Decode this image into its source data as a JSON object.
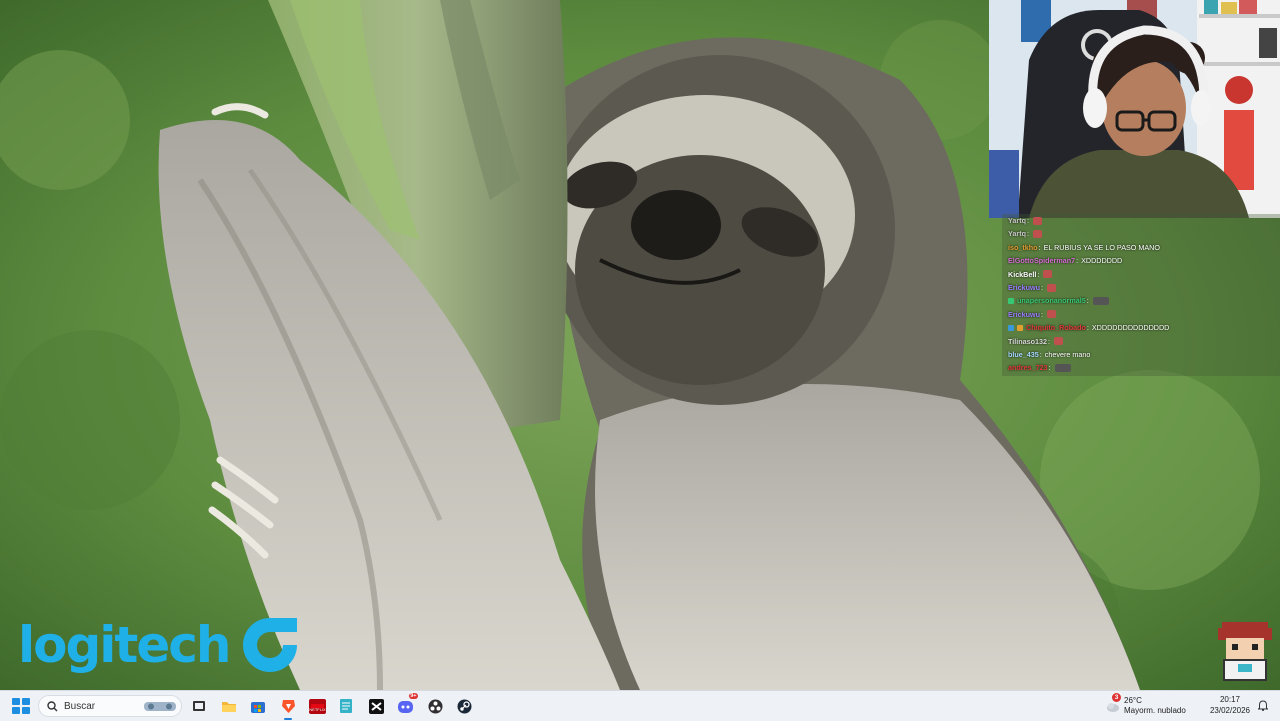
{
  "desktop": {
    "brand_text": "logitech"
  },
  "chat": {
    "messages": [
      {
        "user": "Yartq",
        "text": "",
        "color": "#c8c8c8",
        "emote": "#c0504d"
      },
      {
        "user": "Yartq",
        "text": "",
        "color": "#c8c8c8",
        "emote": "#c0504d"
      },
      {
        "user": "iso_tkho",
        "text": "EL RUBIUS YA SE LO PASO MANO",
        "color": "#e09a2e",
        "emote": ""
      },
      {
        "user": "ElGottoSpiderman7",
        "text": "XDDDDDDD",
        "color": "#d46bd1",
        "emote": ""
      },
      {
        "user": "KickBell",
        "text": "",
        "color": "#ffffff",
        "emote": "#c0504d"
      },
      {
        "user": "Erickuwu",
        "text": "",
        "color": "#9a7cff",
        "emote": "#c0504d"
      },
      {
        "user": "unapersonanormal5",
        "text": "",
        "color": "#37c873",
        "emote": "#555555"
      },
      {
        "user": "Erickuwu",
        "text": "",
        "color": "#9a7cff",
        "emote": "#c0504d"
      },
      {
        "user": "Chiquito_Robado",
        "text": "XDDDDDDDDDDDDDD",
        "color": "#e0383a",
        "emote": ""
      },
      {
        "user": "Tilinaso132",
        "text": "",
        "color": "#d8d8d8",
        "emote": "#c0504d"
      },
      {
        "user": "blue_435",
        "text": "chevere mano",
        "color": "#a8d8ff",
        "emote": ""
      },
      {
        "user": "andres_723",
        "text": "",
        "color": "#e0383a",
        "emote": "#555555"
      }
    ]
  },
  "taskbar": {
    "search_placeholder": "Buscar",
    "apps": [
      "file-explorer-icon",
      "folder-icon",
      "store-icon",
      "brave-icon",
      "netflix-icon",
      "notepad-icon",
      "capcut-icon",
      "discord-icon",
      "obs-icon",
      "steam-icon"
    ],
    "discord_badge": "9+",
    "weather_badge": "3",
    "temperature": "26°C",
    "weather_desc": "Mayorm. nublado",
    "time": "20:17",
    "date": "23/02/2026"
  },
  "colors": {
    "accent": "#1e8fe0",
    "logitech_blue": "#1fb0e8"
  }
}
